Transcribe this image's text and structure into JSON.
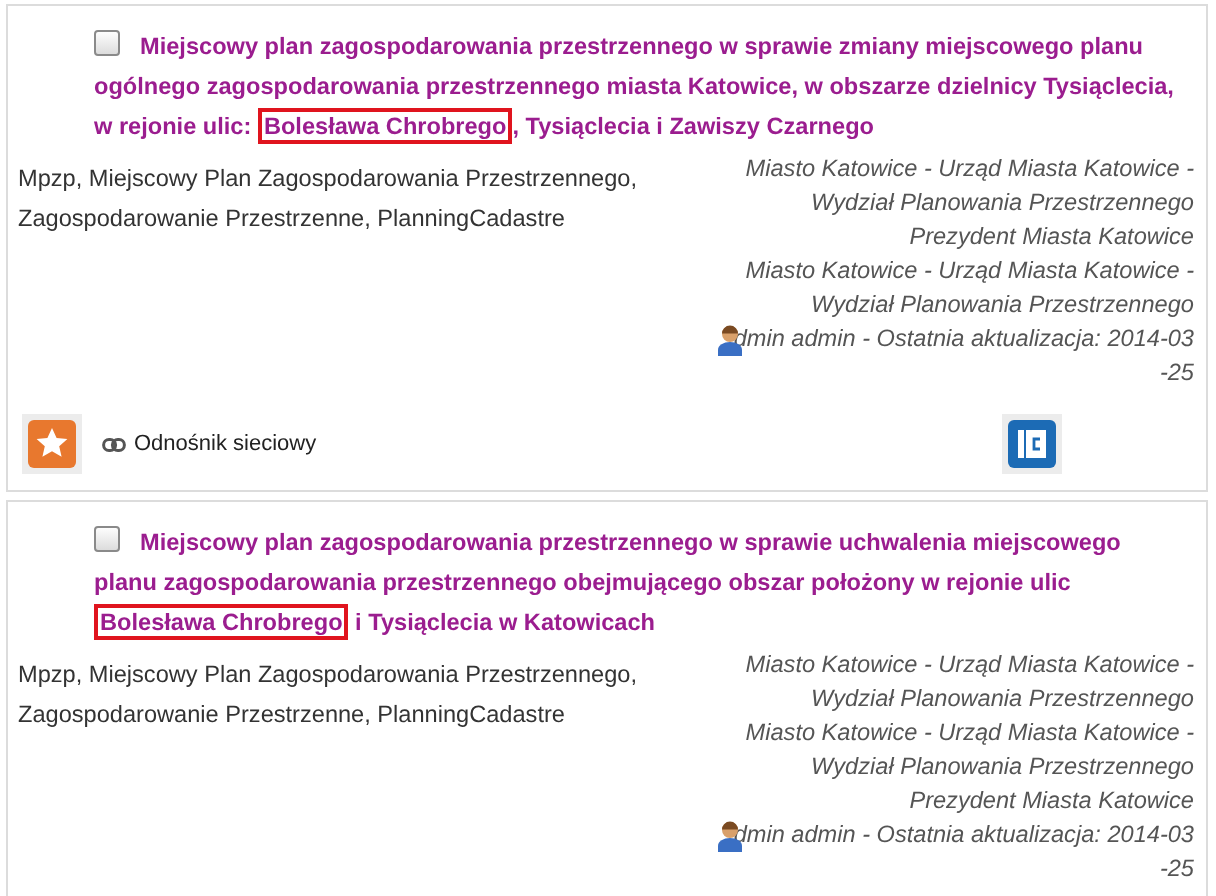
{
  "results": [
    {
      "checked": false,
      "title": [
        {
          "text": "Miejscowy plan zagospodarowania przestrzennego w sprawie zmiany miejscowego planu ogólnego zagospodarowania przestrzennego miasta Katowice, w obszarze dzielnicy Tysiąclecia, w rejonie ulic: ",
          "highlighted": false
        },
        {
          "text": "Bolesława Chrobrego",
          "highlighted": true
        },
        {
          "text": ", Tysiąclecia i Zawiszy Czarnego",
          "highlighted": false
        }
      ],
      "keywords": "Mpzp, Miejscowy Plan Zagospodarowania Przestrzennego, Zagospodarowanie Przestrzenne, PlanningCadastre",
      "authors": [
        "Miasto Katowice - Urząd Miasta Katowice -",
        "Wydział Planowania Przestrzennego",
        "Prezydent Miasta Katowice",
        "Miasto Katowice - Urząd Miasta Katowice -",
        "Wydział Planowania Przestrzennego"
      ],
      "updated": [
        "dmin admin - Ostatnia aktualizacja: 2014-03",
        "-25"
      ],
      "link": "Odnośnik sieciowy"
    },
    {
      "checked": false,
      "title": [
        {
          "text": "Miejscowy plan zagospodarowania przestrzennego w sprawie uchwalenia miejscowego planu zagospodarowania przestrzennego obejmującego obszar położony w rejonie ulic ",
          "highlighted": false
        },
        {
          "text": "Bolesława Chrobrego",
          "highlighted": true
        },
        {
          "text": " i Tysiąclecia w Katowicach",
          "highlighted": false
        }
      ],
      "keywords": "Mpzp, Miejscowy Plan Zagospodarowania Przestrzennego, Zagospodarowanie Przestrzenne, PlanningCadastre",
      "authors": [
        "Miasto Katowice - Urząd Miasta Katowice -",
        "Wydział Planowania Przestrzennego",
        "Miasto Katowice - Urząd Miasta Katowice -",
        "Wydział Planowania Przestrzennego",
        "Prezydent Miasta Katowice"
      ],
      "updated": [
        "dmin admin - Ostatnia aktualizacja: 2014-03",
        "-25"
      ]
    }
  ]
}
